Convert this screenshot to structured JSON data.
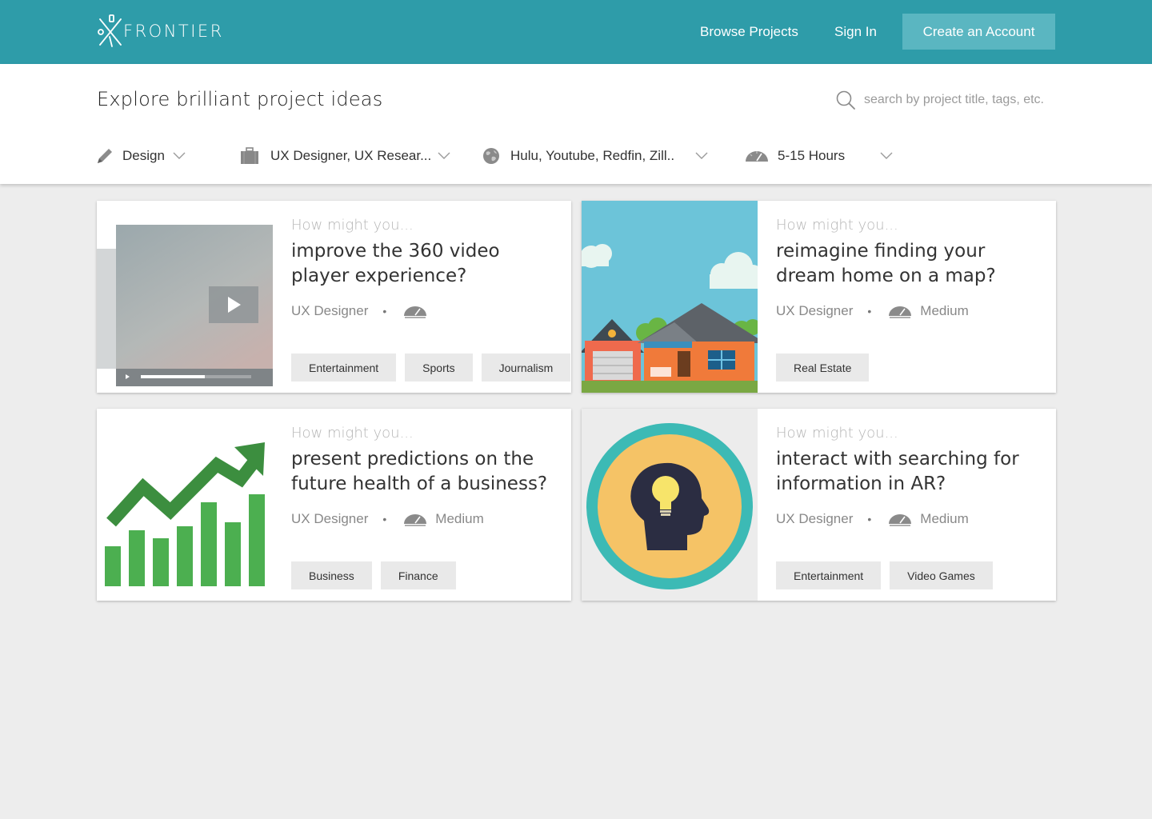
{
  "brand": {
    "name": "FRONTIER"
  },
  "nav": {
    "browse": "Browse Projects",
    "signin": "Sign In",
    "create": "Create an Account"
  },
  "header": {
    "title": "Explore brilliant project ideas",
    "search_placeholder": "search by project title, tags, etc."
  },
  "filters": {
    "category": {
      "icon": "pencil-icon",
      "label": "Design"
    },
    "roles": {
      "icon": "briefcase-icon",
      "label": "UX Designer, UX Resear..."
    },
    "companies": {
      "icon": "globe-icon",
      "label": "Hulu, Youtube, Redfin, Zill.."
    },
    "time": {
      "icon": "speedometer-icon",
      "label": "5-15 Hours"
    }
  },
  "cards": [
    {
      "prompt": "How might you...",
      "title": "improve the 360 video player experience?",
      "role": "UX Designer",
      "difficulty": "",
      "tags": [
        "Entertainment",
        "Sports",
        "Journalism"
      ],
      "thumbnail": "video-player-thumbnail"
    },
    {
      "prompt": "How might you...",
      "title": "reimagine finding your dream home on a map?",
      "role": "UX Designer",
      "difficulty": "Medium",
      "tags": [
        "Real Estate"
      ],
      "thumbnail": "houses-illustration"
    },
    {
      "prompt": "How might you...",
      "title": "present predictions on the future health of a business?",
      "role": "UX Designer",
      "difficulty": "Medium",
      "tags": [
        "Business",
        "Finance"
      ],
      "thumbnail": "growth-chart-illustration"
    },
    {
      "prompt": "How might you...",
      "title": "interact with searching for information in AR?",
      "role": "UX Designer",
      "difficulty": "Medium",
      "tags": [
        "Entertainment",
        "Video Games"
      ],
      "thumbnail": "lightbulb-head-illustration"
    }
  ],
  "colors": {
    "primary": "#2e9ca9",
    "button": "#5ab6c1",
    "background": "#ededed",
    "tag": "#e9e9e9",
    "chart_green": "#4caf50"
  }
}
